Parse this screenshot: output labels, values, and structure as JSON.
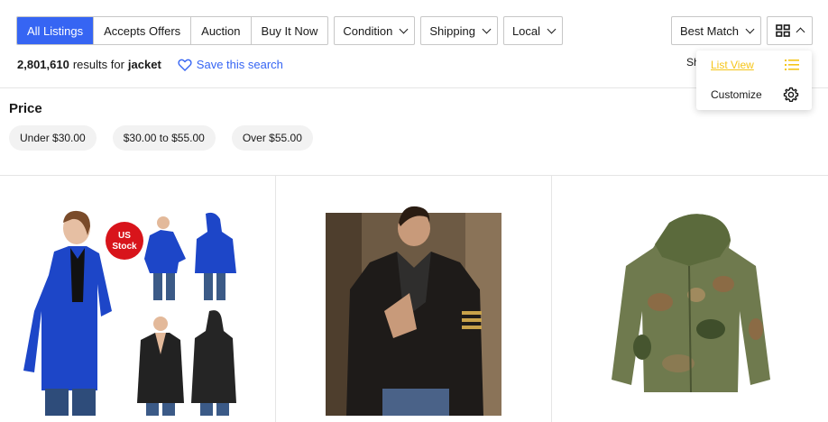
{
  "filters": {
    "segments": [
      {
        "label": "All Listings",
        "active": true
      },
      {
        "label": "Accepts Offers",
        "active": false
      },
      {
        "label": "Auction",
        "active": false
      },
      {
        "label": "Buy It Now",
        "active": false
      }
    ],
    "dropdowns": [
      "Condition",
      "Shipping",
      "Local"
    ]
  },
  "sort": {
    "label": "Best Match"
  },
  "results": {
    "count": "2,801,610",
    "middle": "results for",
    "query": "jacket",
    "save_label": "Save this search",
    "ship_partial": "Sh"
  },
  "price": {
    "title": "Price",
    "chips": [
      "Under $30.00",
      "$30.00 to $55.00",
      "Over $55.00"
    ]
  },
  "view_menu": {
    "list_view": "List View",
    "customize": "Customize"
  },
  "products": [
    {
      "image": "blue and black women's windbreaker jackets with US Stock badge",
      "badge": "US Stock"
    },
    {
      "image": "man in black leather motorcycle jacket"
    },
    {
      "image": "camouflage hooded field jacket"
    }
  ],
  "colors": {
    "accent": "#3665f3",
    "highlight": "#f5c518",
    "border": "#c7c7c7",
    "chip_bg": "#f2f2f2"
  }
}
